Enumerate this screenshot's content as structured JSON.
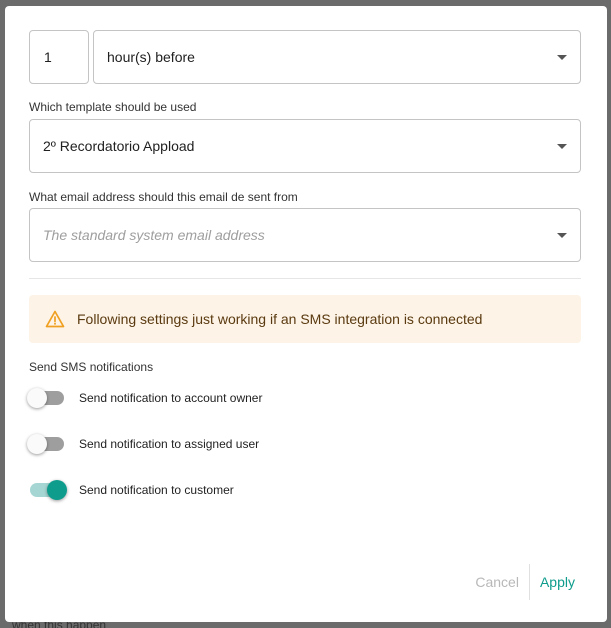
{
  "timing": {
    "amount": "1",
    "unit": "hour(s) before"
  },
  "template": {
    "label": "Which template should be used",
    "selected": "2º Recordatorio Appload"
  },
  "sender": {
    "label": "What email address should this email de sent from",
    "placeholder": "The standard system email address"
  },
  "alert": {
    "text": "Following settings just working if an SMS integration is connected",
    "icon": "warning-icon",
    "color": "#fdf3e6"
  },
  "sms": {
    "heading": "Send SMS notifications",
    "toggles": [
      {
        "label": "Send notification to account owner",
        "on": false
      },
      {
        "label": "Send notification to assigned user",
        "on": false
      },
      {
        "label": "Send notification to customer",
        "on": true
      }
    ]
  },
  "actions": {
    "cancel": "Cancel",
    "apply": "Apply"
  },
  "accent_color": "#0e9c8c",
  "background_text": "when this happen"
}
